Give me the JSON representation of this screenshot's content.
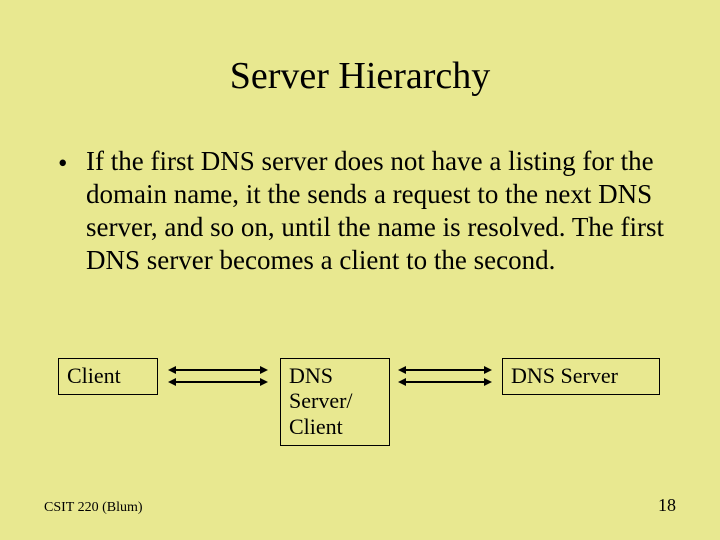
{
  "slide": {
    "title": "Server Hierarchy",
    "bullet": "If the first DNS server does not have a listing for the domain name, it the sends a request to the next DNS server, and so on, until the name is resolved.  The first DNS server becomes a client to the second."
  },
  "diagram": {
    "nodes": {
      "client": "Client",
      "mid": "DNS Server/ Client",
      "server": "DNS Server"
    }
  },
  "footer": {
    "left": "CSIT 220 (Blum)",
    "page": "18"
  }
}
